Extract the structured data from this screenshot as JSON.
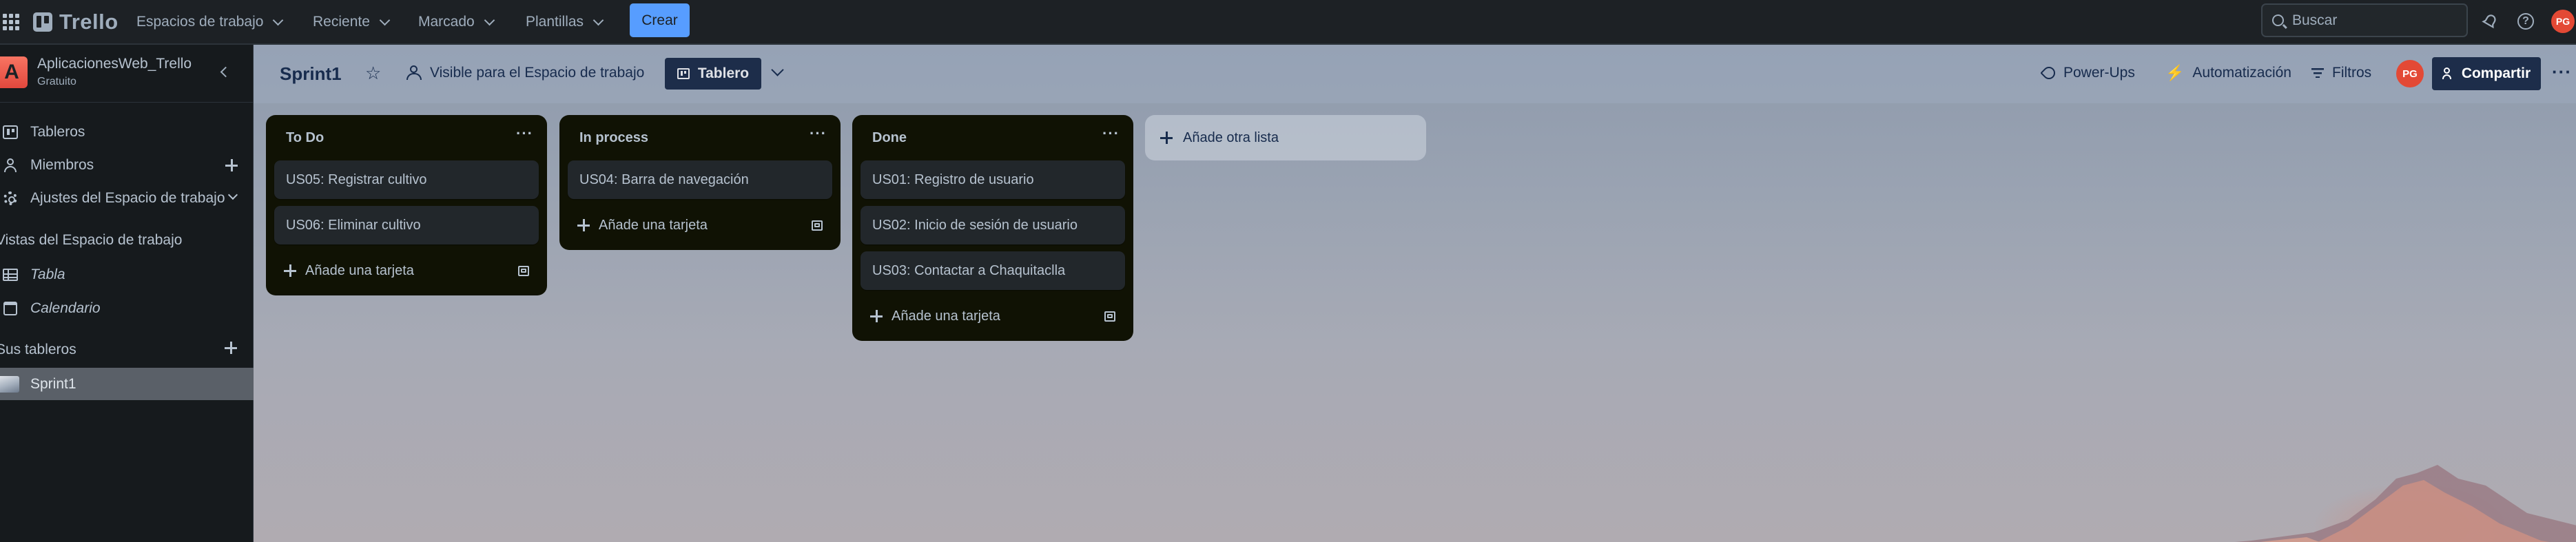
{
  "topnav": {
    "logo": "Trello",
    "menus": [
      "Espacios de trabajo",
      "Reciente",
      "Marcado",
      "Plantillas"
    ],
    "create": "Crear",
    "search_placeholder": "Buscar",
    "avatar_initials": "PG"
  },
  "sidebar": {
    "workspace_initial": "A",
    "workspace_name": "AplicacionesWeb_Trello",
    "workspace_plan": "Gratuito",
    "items": [
      {
        "label": "Tableros"
      },
      {
        "label": "Miembros"
      },
      {
        "label": "Ajustes del Espacio de trabajo"
      }
    ],
    "views_section": "Vistas del Espacio de trabajo",
    "views": [
      {
        "label": "Tabla"
      },
      {
        "label": "Calendario"
      }
    ],
    "boards_section": "Sus tableros",
    "boards": [
      {
        "label": "Sprint1"
      }
    ]
  },
  "board": {
    "title": "Sprint1",
    "visibility": "Visible para el Espacio de trabajo",
    "view": "Tablero",
    "powerups": "Power-Ups",
    "automation": "Automatización",
    "filters": "Filtros",
    "member_initials": "PG",
    "share": "Compartir",
    "lists": [
      {
        "title": "To Do",
        "cards": [
          "US05: Registrar cultivo",
          "US06: Eliminar cultivo"
        ],
        "add_card": "Añade una tarjeta"
      },
      {
        "title": "In process",
        "cards": [
          "US04: Barra de navegación"
        ],
        "add_card": "Añade una tarjeta"
      },
      {
        "title": "Done",
        "cards": [
          "US01: Registro de usuario",
          "US02: Inicio de sesión de usuario",
          "US03: Contactar a Chaquitaclla"
        ],
        "add_card": "Añade una tarjeta"
      }
    ],
    "add_list": "Añade otra lista"
  },
  "colors": {
    "nav_bg": "#1d2125",
    "create_button": "#579dff",
    "list_bg": "#101204",
    "card_bg": "#22272b",
    "avatar_red": "#e34935",
    "share_button": "#1d2d4a"
  }
}
